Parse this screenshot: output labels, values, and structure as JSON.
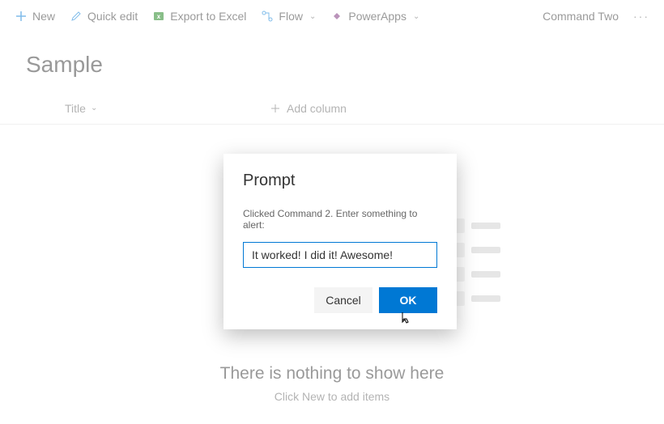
{
  "toolbar": {
    "new_label": "New",
    "quick_edit_label": "Quick edit",
    "export_label": "Export to Excel",
    "flow_label": "Flow",
    "powerapps_label": "PowerApps",
    "command_two_label": "Command Two",
    "more_label": "···"
  },
  "page": {
    "title": "Sample"
  },
  "columns": {
    "title_header": "Title",
    "add_column_label": "Add column"
  },
  "empty_state": {
    "title": "There is nothing to show here",
    "subtitle": "Click New to add items"
  },
  "dialog": {
    "title": "Prompt",
    "message": "Clicked Command 2. Enter something to alert:",
    "input_value": "It worked! I did it! Awesome!",
    "cancel_label": "Cancel",
    "ok_label": "OK"
  }
}
